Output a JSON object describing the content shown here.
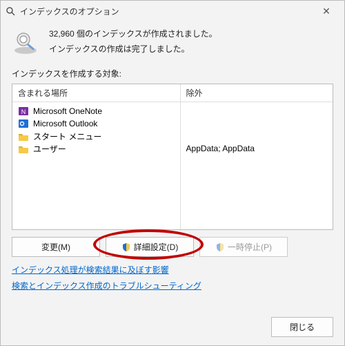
{
  "title": "インデックスのオプション",
  "status": {
    "count_line": "32,960 個のインデックスが作成されました。",
    "complete_line": "インデックスの作成は完了しました。"
  },
  "targets_label": "インデックスを作成する対象:",
  "columns": {
    "included": "含まれる場所",
    "excluded": "除外"
  },
  "locations": [
    {
      "icon": "onenote-icon",
      "label": "Microsoft OneNote",
      "exclude": ""
    },
    {
      "icon": "outlook-icon",
      "label": "Microsoft Outlook",
      "exclude": ""
    },
    {
      "icon": "folder-icon",
      "label": "スタート メニュー",
      "exclude": ""
    },
    {
      "icon": "folder-icon",
      "label": "ユーザー",
      "exclude": "AppData; AppData"
    }
  ],
  "buttons": {
    "modify": "変更(M)",
    "advanced": "詳細設定(D)",
    "pause": "一時停止(P)",
    "close": "閉じる"
  },
  "links": {
    "affects": "インデックス処理が検索結果に及ぼす影響",
    "troubleshoot": "検索とインデックス作成のトラブルシューティング"
  }
}
